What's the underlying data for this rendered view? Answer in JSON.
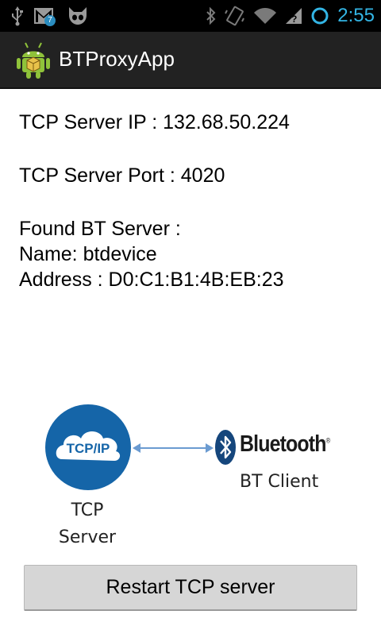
{
  "status_bar": {
    "time": "2:55",
    "notification_count": "7",
    "left_icons": [
      "usb-icon",
      "gmail-icon",
      "cyanogen-icon"
    ],
    "right_icons": [
      "bluetooth-icon",
      "vibrate-icon",
      "wifi-icon",
      "signal-icon",
      "battery-icon"
    ],
    "clock_color": "#33b5e5"
  },
  "action_bar": {
    "title": "BTProxyApp",
    "icon": "android-app-icon",
    "background": "#222222"
  },
  "info": {
    "tcp_ip": "TCP Server IP : 132.68.50.224",
    "tcp_port": "TCP Server Port : 4020",
    "found_heading": "Found BT Server :",
    "bt_name": "Name: btdevice",
    "bt_address": "Address : D0:C1:B1:4B:EB:23"
  },
  "diagram": {
    "tcp_logo_text": "TCP/IP",
    "tcp_caption_line1": "TCP",
    "tcp_caption_line2": "Server",
    "bluetooth_word": "Bluetooth",
    "bluetooth_mark": "®",
    "bt_caption": "BT Client",
    "cloud_color": "#1565a8",
    "arrow_color": "#6b9bd1"
  },
  "button": {
    "label": "Restart TCP server"
  }
}
